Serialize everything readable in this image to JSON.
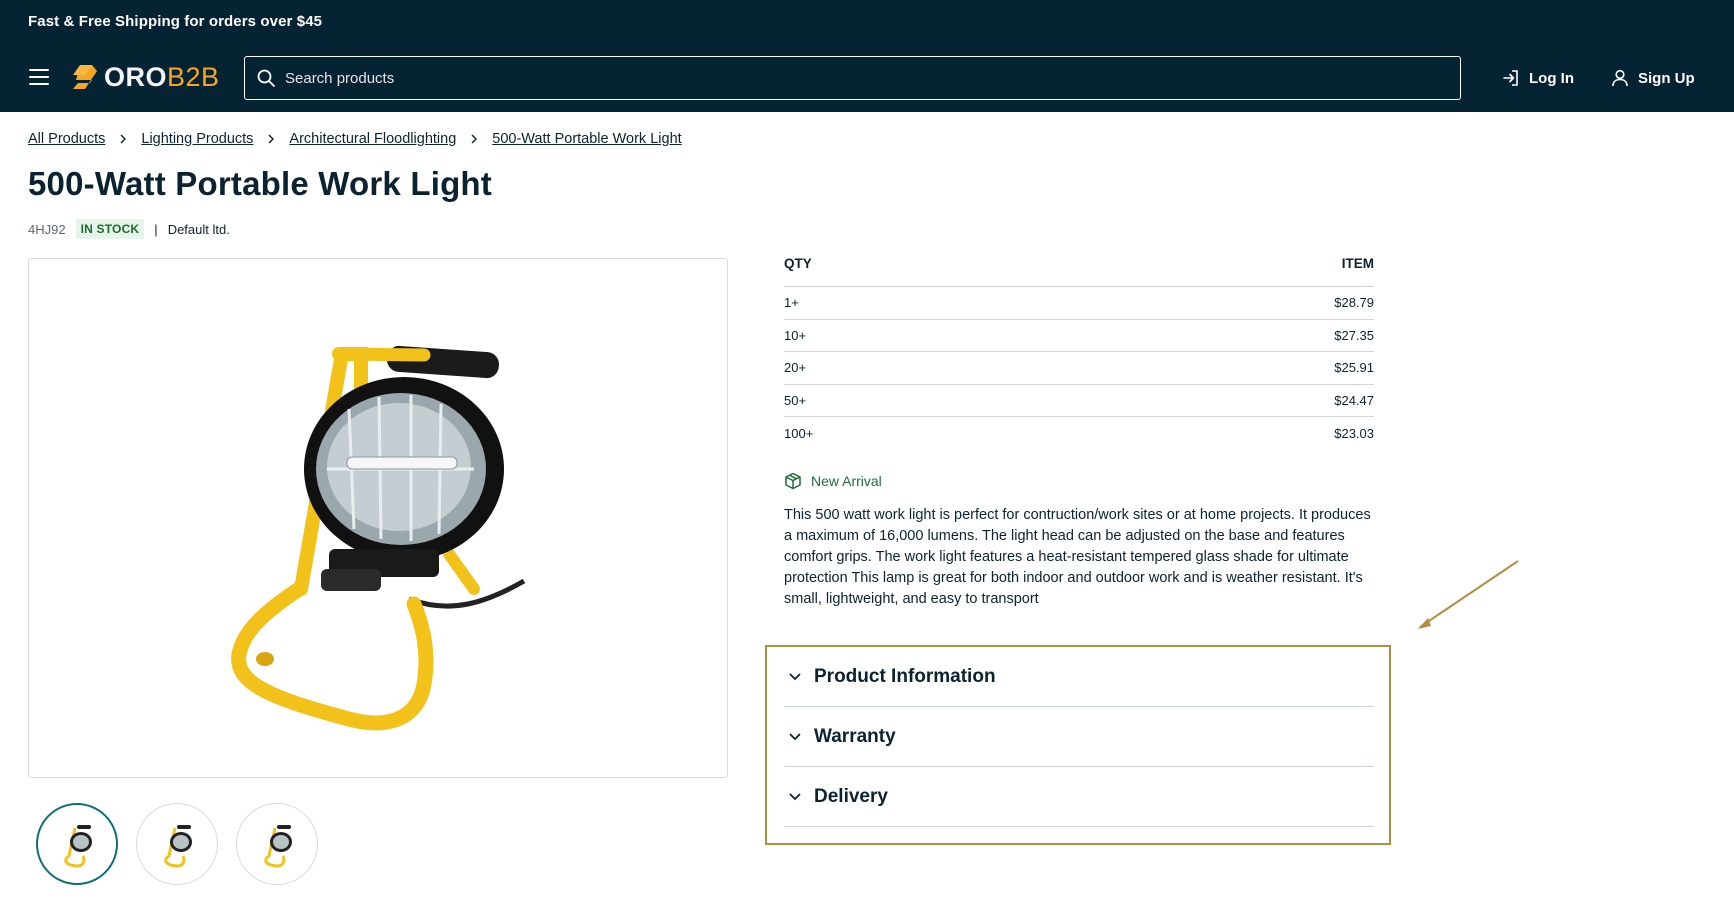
{
  "header": {
    "promo": "Fast & Free Shipping for orders over $45",
    "logo": {
      "part1": "ORO",
      "part2": "B2B"
    },
    "search": {
      "placeholder": "Search products",
      "value": ""
    },
    "login_label": "Log In",
    "signup_label": "Sign Up"
  },
  "breadcrumb": [
    "All Products",
    "Lighting Products",
    "Architectural Floodlighting",
    "500-Watt Portable Work Light"
  ],
  "product": {
    "title": "500-Watt Portable Work Light",
    "sku": "4HJ92",
    "stock": "IN STOCK",
    "seller": "Default ltd.",
    "badge": "New Arrival",
    "description": "This 500 watt work light is perfect for contruction/work sites or at home projects. It produces a maximum of 16,000 lumens. The light head can be adjusted on the base and features comfort grips. The work light features a heat-resistant tempered glass shade for ultimate protection This lamp is great for both indoor and outdoor work and is weather resistant. It's small, lightweight, and easy to transport"
  },
  "price_table": {
    "headers": {
      "qty": "QTY",
      "item": "ITEM"
    },
    "rows": [
      {
        "qty": "1+",
        "price": "$28.79"
      },
      {
        "qty": "10+",
        "price": "$27.35"
      },
      {
        "qty": "20+",
        "price": "$25.91"
      },
      {
        "qty": "50+",
        "price": "$24.47"
      },
      {
        "qty": "100+",
        "price": "$23.03"
      }
    ]
  },
  "accordion": [
    "Product Information",
    "Warranty",
    "Delivery"
  ],
  "thumbnails": {
    "count": 3,
    "active_index": 0
  },
  "colors": {
    "header_bg": "#062333",
    "logo_accent": "#f5a623",
    "in_stock_bg": "#e6f4ea",
    "in_stock_text": "#1c6b2c",
    "highlight": "#b98b3e",
    "active_thumb": "#0c6f72"
  },
  "icons": [
    "menu-icon",
    "logo-icon",
    "search-icon",
    "login-icon",
    "user-icon",
    "chevron-right-icon",
    "package-icon",
    "chevron-down-icon"
  ]
}
